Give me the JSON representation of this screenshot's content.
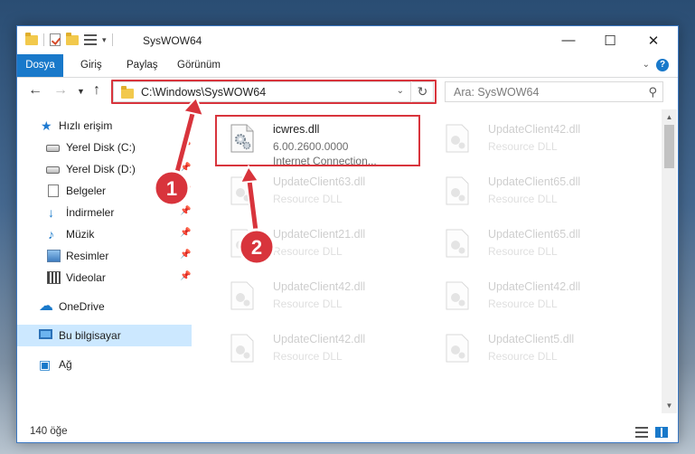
{
  "window": {
    "title": "SysWOW64"
  },
  "ribbon": {
    "tabs": [
      {
        "label": "Dosya",
        "active": true
      },
      {
        "label": "Giriş",
        "active": false
      },
      {
        "label": "Paylaş",
        "active": false
      },
      {
        "label": "Görünüm",
        "active": false
      }
    ]
  },
  "nav": {
    "address": "C:\\Windows\\SysWOW64",
    "search_placeholder": "Ara: SysWOW64"
  },
  "sidebar": {
    "items": [
      {
        "label": "Hızlı erişim",
        "icon": "star-icon",
        "pinned": false
      },
      {
        "label": "Yerel Disk (C:)",
        "icon": "disk-icon",
        "pinned": true
      },
      {
        "label": "Yerel Disk (D:)",
        "icon": "disk-icon",
        "pinned": true
      },
      {
        "label": "Belgeler",
        "icon": "documents-icon",
        "pinned": true
      },
      {
        "label": "İndirmeler",
        "icon": "download-icon",
        "pinned": true
      },
      {
        "label": "Müzik",
        "icon": "music-icon",
        "pinned": true
      },
      {
        "label": "Resimler",
        "icon": "pictures-icon",
        "pinned": true
      },
      {
        "label": "Videolar",
        "icon": "videos-icon",
        "pinned": true
      },
      {
        "label": "OneDrive",
        "icon": "cloud-icon",
        "pinned": false
      },
      {
        "label": "Bu bilgisayar",
        "icon": "computer-icon",
        "pinned": false,
        "selected": true
      },
      {
        "label": "Ağ",
        "icon": "network-icon",
        "pinned": false
      }
    ]
  },
  "files": [
    {
      "name": "icwres.dll",
      "line2": "6.00.2600.0000",
      "line3": "Internet Connection...",
      "highlighted": true
    },
    {
      "name": "UpdateClient42.dll",
      "line2": "Resource DLL",
      "faded": true
    },
    {
      "name": "UpdateClient63.dll",
      "line2": "Resource DLL",
      "faded": true
    },
    {
      "name": "UpdateClient65.dll",
      "line2": "Resource DLL",
      "faded": true
    },
    {
      "name": "UpdateClient21.dll",
      "line2": "Resource DLL",
      "faded": true
    },
    {
      "name": "UpdateClient65.dll",
      "line2": "Resource DLL",
      "faded": true
    },
    {
      "name": "UpdateClient42.dll",
      "line2": "Resource DLL",
      "faded": true
    },
    {
      "name": "UpdateClient42.dll",
      "line2": "Resource DLL",
      "faded": true
    },
    {
      "name": "UpdateClient42.dll",
      "line2": "Resource DLL",
      "faded": true
    },
    {
      "name": "UpdateClient5.dll",
      "line2": "Resource DLL",
      "faded": true
    }
  ],
  "status": {
    "item_count": "140 öğe"
  },
  "annotations": {
    "badge1": "1",
    "badge2": "2",
    "color": "#d8343c"
  }
}
